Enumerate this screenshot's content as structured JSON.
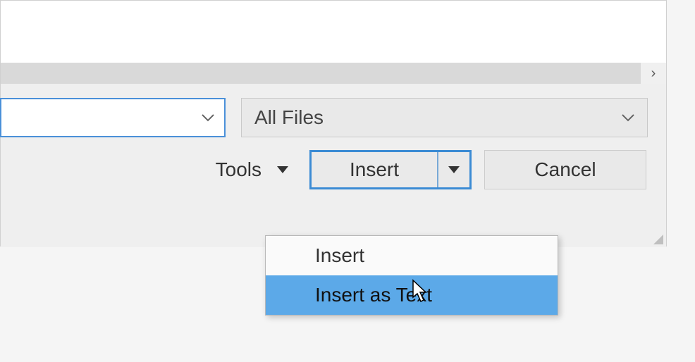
{
  "dialog": {
    "filename_value": "",
    "filetype_label": "All Files",
    "tools_label": "Tools",
    "insert_label": "Insert",
    "cancel_label": "Cancel",
    "scroll_arrow_right": "›"
  },
  "dropdown": {
    "items": [
      {
        "label": "Insert"
      },
      {
        "label": "Insert as Text"
      }
    ]
  }
}
